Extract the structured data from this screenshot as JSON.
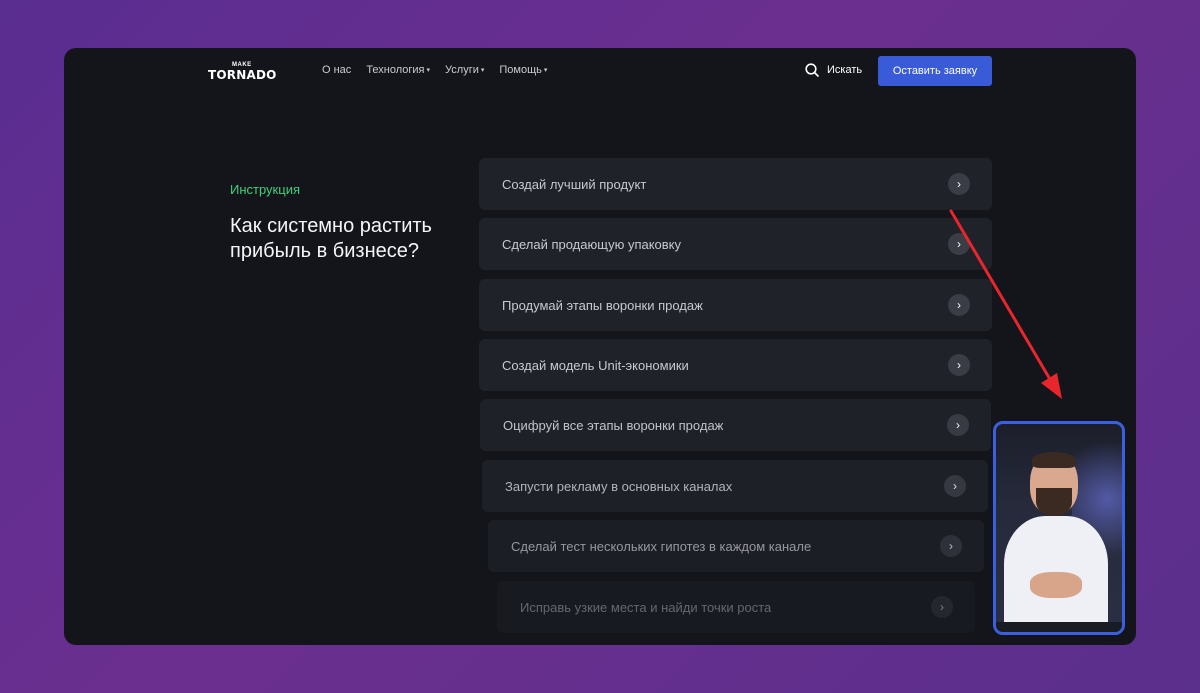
{
  "header": {
    "logo_top": "MAKE",
    "logo_main": "TORNADO",
    "nav": [
      {
        "label": "О нас",
        "has_caret": false
      },
      {
        "label": "Технология",
        "has_caret": true
      },
      {
        "label": "Услуги",
        "has_caret": true
      },
      {
        "label": "Помощь",
        "has_caret": true
      }
    ],
    "caret": "▾",
    "search_label": "Искать",
    "cta_label": "Оставить заявку"
  },
  "intro": {
    "eyebrow": "Инструкция",
    "headline": "Как системно растить прибыль в бизнесе?"
  },
  "steps": [
    {
      "label": "Создай лучший продукт"
    },
    {
      "label": "Сделай продающую упаковку"
    },
    {
      "label": "Продумай этапы воронки продаж"
    },
    {
      "label": "Создай модель Unit-экономики"
    },
    {
      "label": "Оцифруй все этапы воронки продаж"
    },
    {
      "label": "Запусти рекламу в основных каналах"
    },
    {
      "label": "Сделай тест нескольких гипотез в каждом канале"
    },
    {
      "label": "Исправь узкие места и найди точки роста"
    }
  ],
  "arrow_glyph": "›",
  "colors": {
    "accent": "#3a5bd8",
    "eyebrow": "#3fd17a",
    "annotation": "#e8262b",
    "video_border": "#3b5fe0"
  },
  "icons": {
    "search": "search-icon",
    "step": "chevron-right-icon"
  }
}
